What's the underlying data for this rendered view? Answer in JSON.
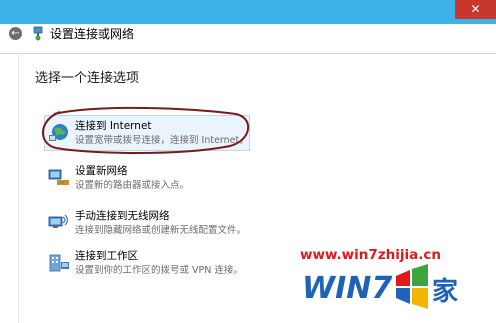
{
  "window": {
    "close_glyph": "✕",
    "accent": "#3cb1ea",
    "close_color": "#c7372c"
  },
  "header": {
    "back_glyph": "←",
    "title": "设置连接或网络"
  },
  "main": {
    "heading": "选择一个连接选项",
    "options": [
      {
        "label": "连接到 Internet",
        "desc": "设置宽带或拨号连接，连接到 Internet。",
        "icon": "globe-network-icon",
        "selected": true
      },
      {
        "label": "设置新网络",
        "desc": "设置新的路由器或接入点。",
        "icon": "router-icon"
      },
      {
        "label": "手动连接到无线网络",
        "desc": "连接到隐藏网络或创建新无线配置文件。",
        "icon": "wireless-computer-icon"
      },
      {
        "label": "连接到工作区",
        "desc": "设置到你的工作区的拨号或 VPN 连接。",
        "icon": "workplace-icon"
      }
    ]
  },
  "watermark": {
    "url": "www.win7zhijia.cn",
    "logo_text": "WIN7之家"
  }
}
